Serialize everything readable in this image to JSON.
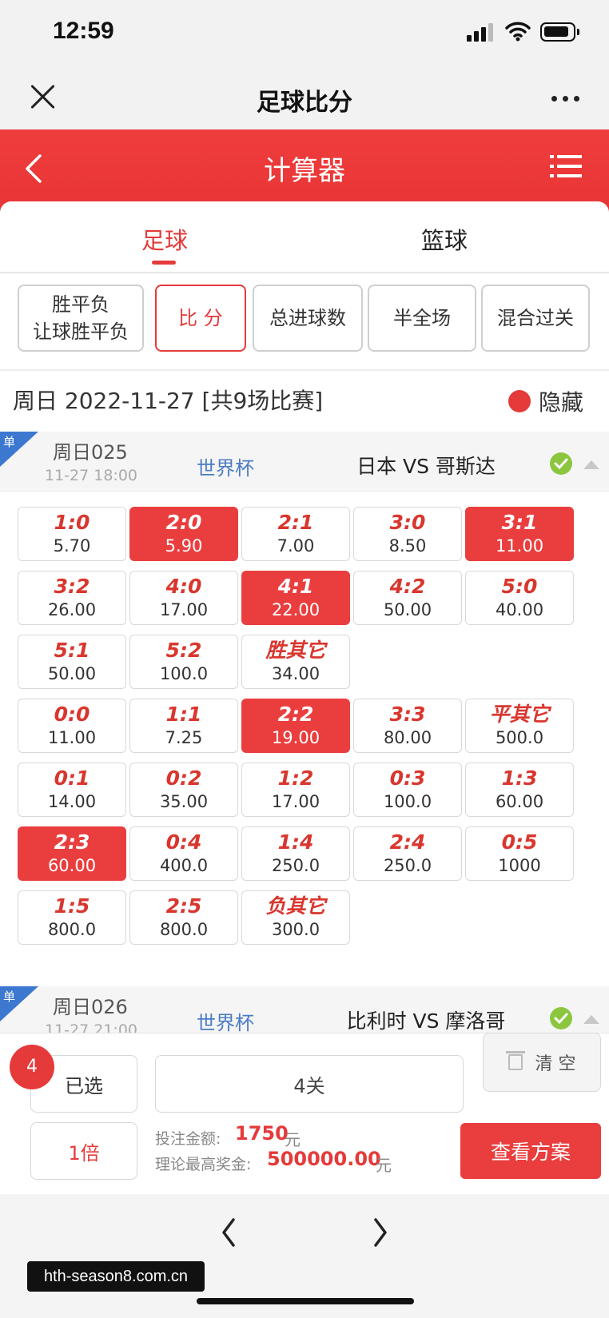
{
  "status_bar": {
    "time": "12:59"
  },
  "nav": {
    "title": "足球比分"
  },
  "header": {
    "title": "计算器"
  },
  "sport_tabs": [
    {
      "label": "足球"
    },
    {
      "label": "篮球"
    }
  ],
  "play_types": [
    {
      "line1": "胜平负",
      "line2": "让球胜平负"
    },
    {
      "label": "比 分"
    },
    {
      "label": "总进球数"
    },
    {
      "label": "半全场"
    },
    {
      "label": "混合过关"
    }
  ],
  "date_bar": {
    "text": "周日 2022-11-27 [共9场比赛]",
    "hide_label": "隐藏"
  },
  "matches": [
    {
      "tag": "单",
      "number": "周日025",
      "time": "11-27 18:00",
      "league": "世界杯",
      "teams": "日本 VS 哥斯达"
    },
    {
      "tag": "单",
      "number": "周日026",
      "time": "11-27 21:00",
      "league": "世界杯",
      "teams": "比利时 VS 摩洛哥"
    }
  ],
  "score_options": [
    {
      "score": "1:0",
      "odds": "5.70",
      "selected": false
    },
    {
      "score": "2:0",
      "odds": "5.90",
      "selected": true
    },
    {
      "score": "2:1",
      "odds": "7.00",
      "selected": false
    },
    {
      "score": "3:0",
      "odds": "8.50",
      "selected": false
    },
    {
      "score": "3:1",
      "odds": "11.00",
      "selected": true
    },
    {
      "score": "3:2",
      "odds": "26.00",
      "selected": false
    },
    {
      "score": "4:0",
      "odds": "17.00",
      "selected": false
    },
    {
      "score": "4:1",
      "odds": "22.00",
      "selected": true
    },
    {
      "score": "4:2",
      "odds": "50.00",
      "selected": false
    },
    {
      "score": "5:0",
      "odds": "40.00",
      "selected": false
    },
    {
      "score": "5:1",
      "odds": "50.00",
      "selected": false
    },
    {
      "score": "5:2",
      "odds": "100.0",
      "selected": false
    },
    {
      "score": "胜其它",
      "odds": "34.00",
      "selected": false
    },
    {
      "score": "0:0",
      "odds": "11.00",
      "selected": false
    },
    {
      "score": "1:1",
      "odds": "7.25",
      "selected": false
    },
    {
      "score": "2:2",
      "odds": "19.00",
      "selected": true
    },
    {
      "score": "3:3",
      "odds": "80.00",
      "selected": false
    },
    {
      "score": "平其它",
      "odds": "500.0",
      "selected": false
    },
    {
      "score": "0:1",
      "odds": "14.00",
      "selected": false
    },
    {
      "score": "0:2",
      "odds": "35.00",
      "selected": false
    },
    {
      "score": "1:2",
      "odds": "17.00",
      "selected": false
    },
    {
      "score": "0:3",
      "odds": "100.0",
      "selected": false
    },
    {
      "score": "1:3",
      "odds": "60.00",
      "selected": false
    },
    {
      "score": "2:3",
      "odds": "60.00",
      "selected": true
    },
    {
      "score": "0:4",
      "odds": "400.0",
      "selected": false
    },
    {
      "score": "1:4",
      "odds": "250.0",
      "selected": false
    },
    {
      "score": "2:4",
      "odds": "250.0",
      "selected": false
    },
    {
      "score": "0:5",
      "odds": "1000",
      "selected": false
    },
    {
      "score": "1:5",
      "odds": "800.0",
      "selected": false
    },
    {
      "score": "2:5",
      "odds": "800.0",
      "selected": false
    },
    {
      "score": "负其它",
      "odds": "300.0",
      "selected": false
    }
  ],
  "bottom": {
    "selected_count": "4",
    "selected_label": "已选",
    "pass_type": "4关",
    "clear_label": "清 空",
    "multiplier": "1倍",
    "bet_amount_label": "投注金额:",
    "bet_amount": "1750",
    "bet_unit": "元",
    "max_prize_label": "理论最高奖金:",
    "max_prize": "500000.00",
    "prize_unit": "元",
    "view_plan_label": "查看方案"
  },
  "watermark": "hth-season8.com.cn",
  "colors": {
    "accent": "#e53a3a",
    "selected_cell": "#ea3e3e",
    "league": "#4a7bc4",
    "check": "#8cc63f"
  }
}
